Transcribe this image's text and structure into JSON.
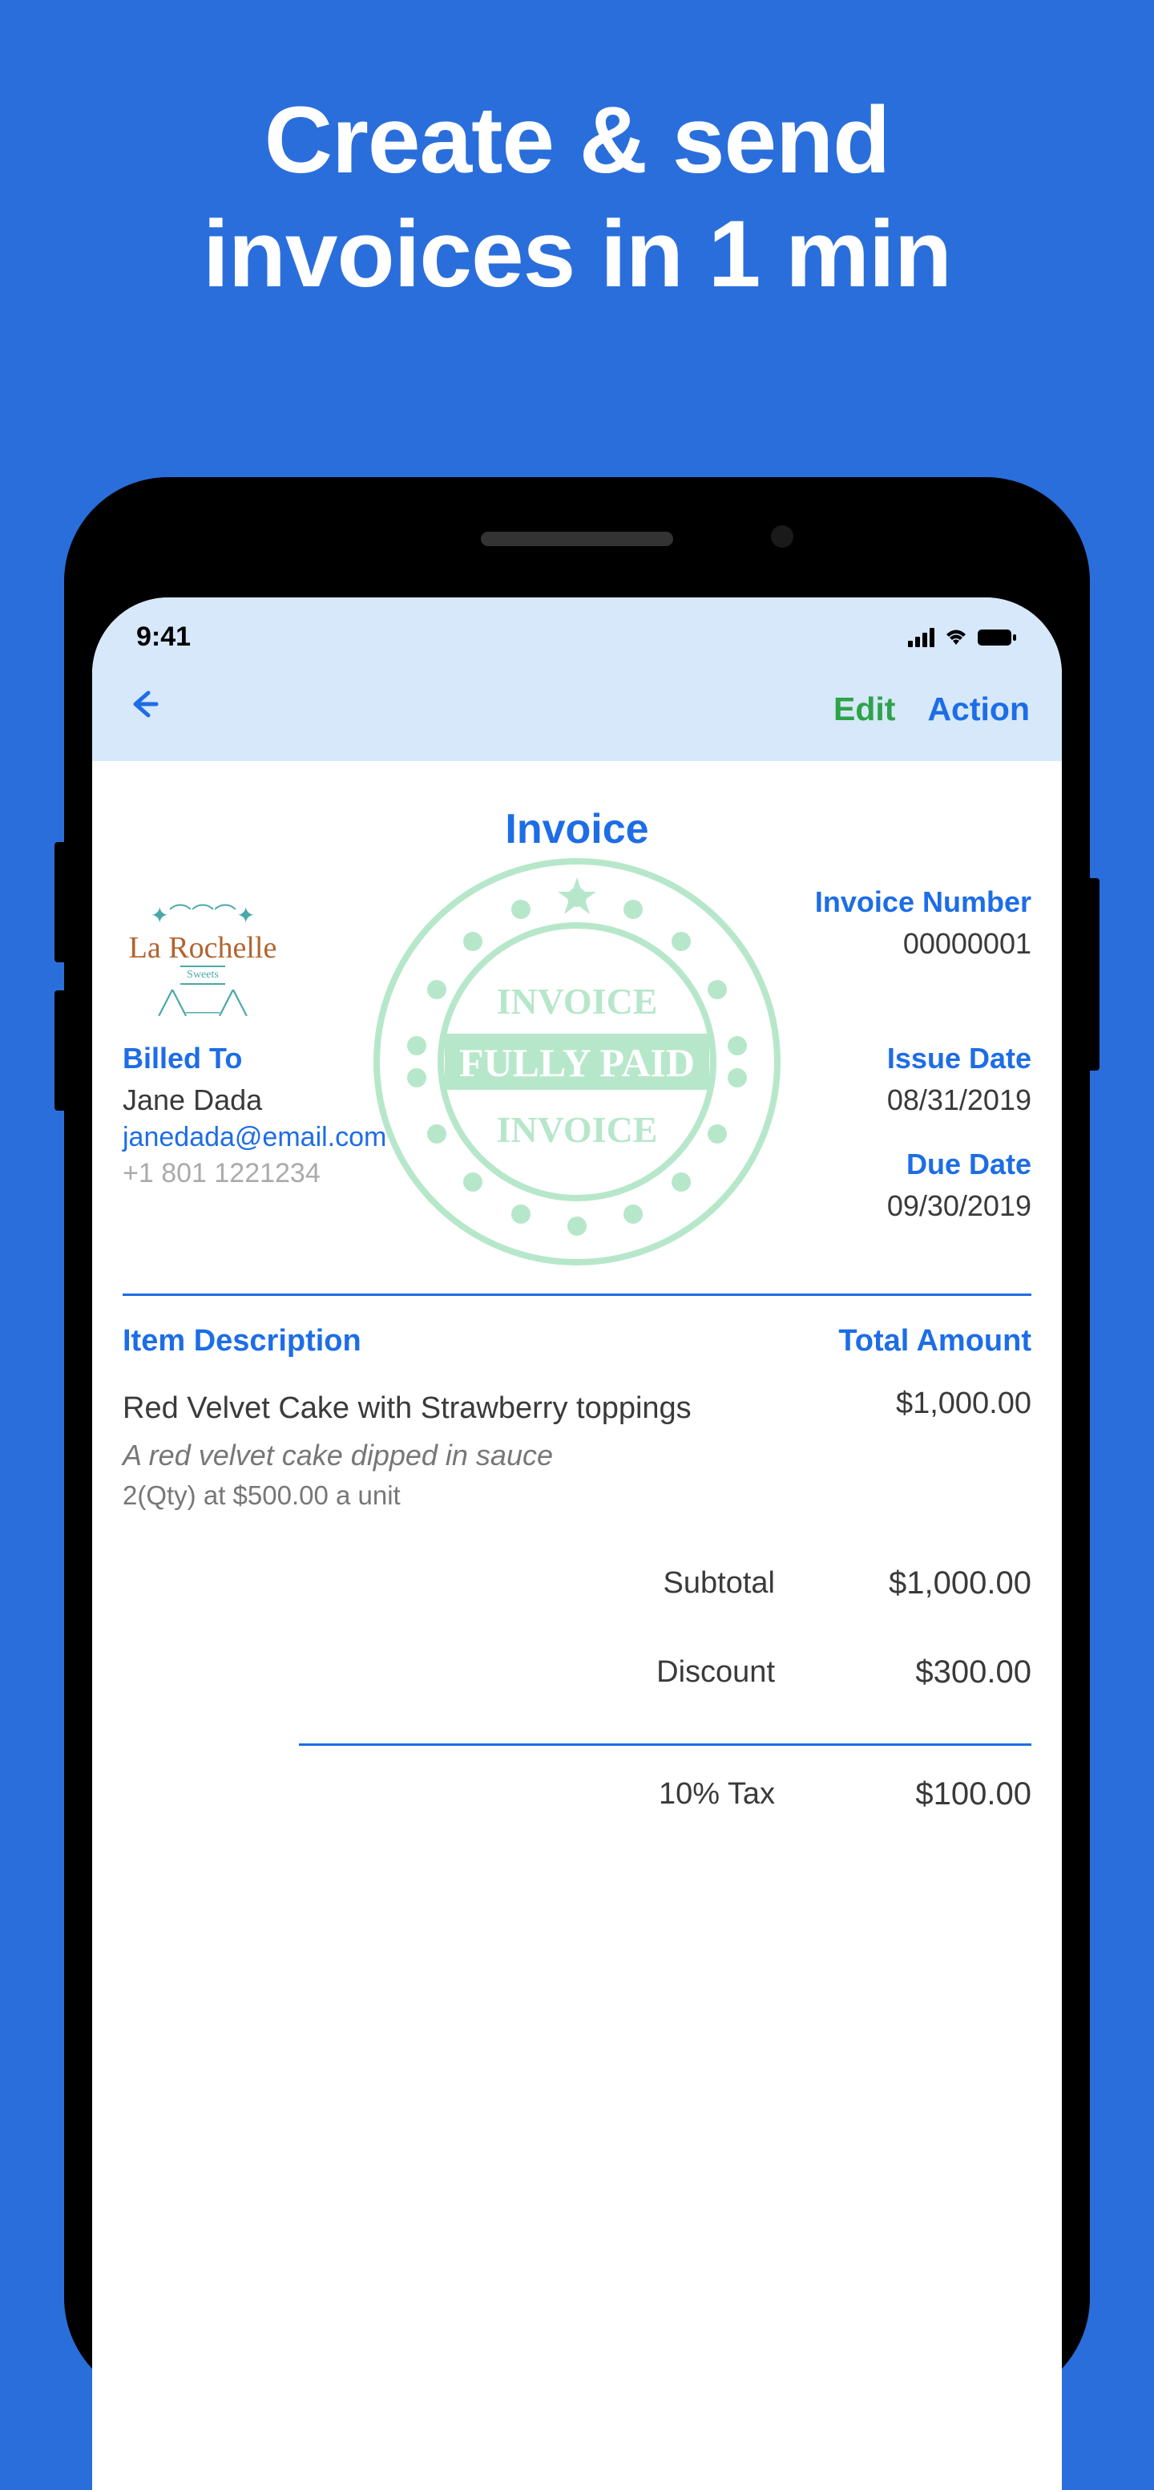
{
  "hero": {
    "title_line1": "Create & send",
    "title_line2": "invoices in 1 min"
  },
  "status": {
    "time": "9:41"
  },
  "nav": {
    "edit_label": "Edit",
    "action_label": "Action"
  },
  "invoice": {
    "title": "Invoice",
    "logo_name": "La Rochelle",
    "logo_subtitle": "Sweets",
    "stamp_top": "INVOICE",
    "stamp_main": "FULLY PAID",
    "stamp_bottom": "INVOICE",
    "invoice_number_label": "Invoice Number",
    "invoice_number": "00000001",
    "billed_to_label": "Billed To",
    "billed_name": "Jane Dada",
    "billed_email": "janedada@email.com",
    "billed_phone": "+1 801 1221234",
    "issue_date_label": "Issue Date",
    "issue_date": "08/31/2019",
    "due_date_label": "Due Date",
    "due_date": "09/30/2019",
    "col_description": "Item Description",
    "col_total": "Total Amount",
    "items": [
      {
        "name": "Red Velvet Cake with Strawberry toppings",
        "desc": "A red velvet cake dipped in sauce",
        "qty_line": "2(Qty) at $500.00 a unit",
        "amount": "$1,000.00"
      }
    ],
    "subtotal_label": "Subtotal",
    "subtotal": "$1,000.00",
    "discount_label": "Discount",
    "discount": "$300.00",
    "tax_label": "10% Tax",
    "tax": "$100.00"
  }
}
